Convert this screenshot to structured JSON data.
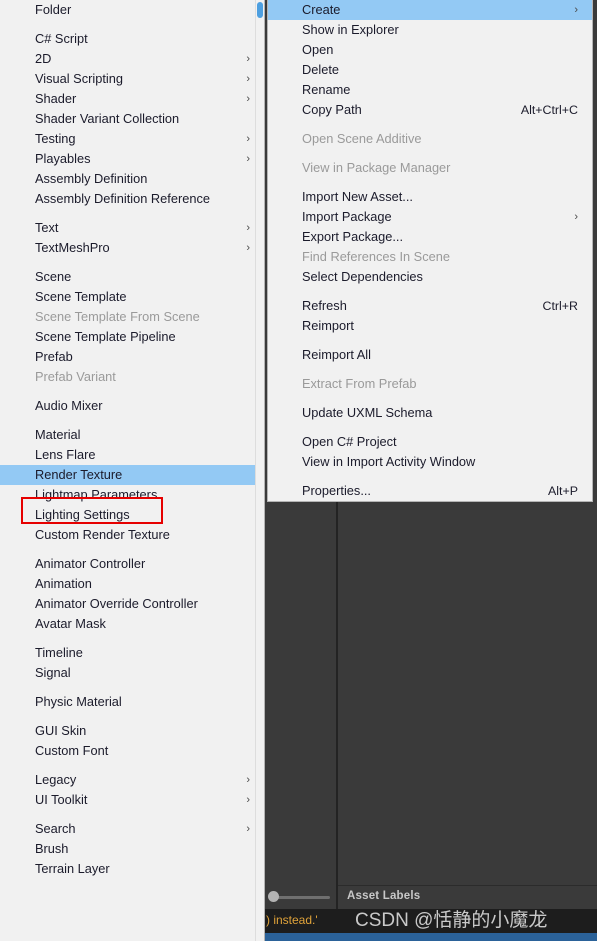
{
  "colors": {
    "menu_bg": "#f1f1f1",
    "highlight": "#93c9f4",
    "annotation": "#e60000",
    "unity_bg": "#383838",
    "console_text": "#e0a33a",
    "status_blue": "#2b6299"
  },
  "create_submenu": {
    "name": "Create",
    "items": [
      {
        "label": "Folder",
        "type": "item"
      },
      {
        "type": "separator"
      },
      {
        "label": "C# Script",
        "type": "item"
      },
      {
        "label": "2D",
        "type": "item",
        "arrow": "›"
      },
      {
        "label": "Visual Scripting",
        "type": "item",
        "arrow": "›"
      },
      {
        "label": "Shader",
        "type": "item",
        "arrow": "›"
      },
      {
        "label": "Shader Variant Collection",
        "type": "item"
      },
      {
        "label": "Testing",
        "type": "item",
        "arrow": "›"
      },
      {
        "label": "Playables",
        "type": "item",
        "arrow": "›"
      },
      {
        "label": "Assembly Definition",
        "type": "item"
      },
      {
        "label": "Assembly Definition Reference",
        "type": "item"
      },
      {
        "type": "separator"
      },
      {
        "label": "Text",
        "type": "item",
        "arrow": "›"
      },
      {
        "label": "TextMeshPro",
        "type": "item",
        "arrow": "›"
      },
      {
        "type": "separator"
      },
      {
        "label": "Scene",
        "type": "item"
      },
      {
        "label": "Scene Template",
        "type": "item"
      },
      {
        "label": "Scene Template From Scene",
        "type": "item",
        "disabled": true
      },
      {
        "label": "Scene Template Pipeline",
        "type": "item"
      },
      {
        "label": "Prefab",
        "type": "item"
      },
      {
        "label": "Prefab Variant",
        "type": "item",
        "disabled": true
      },
      {
        "type": "separator"
      },
      {
        "label": "Audio Mixer",
        "type": "item"
      },
      {
        "type": "separator"
      },
      {
        "label": "Material",
        "type": "item"
      },
      {
        "label": "Lens Flare",
        "type": "item"
      },
      {
        "label": "Render Texture",
        "type": "item",
        "selected": true,
        "annotated": true
      },
      {
        "label": "Lightmap Parameters",
        "type": "item"
      },
      {
        "label": "Lighting Settings",
        "type": "item"
      },
      {
        "label": "Custom Render Texture",
        "type": "item"
      },
      {
        "type": "separator"
      },
      {
        "label": "Animator Controller",
        "type": "item"
      },
      {
        "label": "Animation",
        "type": "item"
      },
      {
        "label": "Animator Override Controller",
        "type": "item"
      },
      {
        "label": "Avatar Mask",
        "type": "item"
      },
      {
        "type": "separator"
      },
      {
        "label": "Timeline",
        "type": "item"
      },
      {
        "label": "Signal",
        "type": "item"
      },
      {
        "type": "separator"
      },
      {
        "label": "Physic Material",
        "type": "item"
      },
      {
        "type": "separator"
      },
      {
        "label": "GUI Skin",
        "type": "item"
      },
      {
        "label": "Custom Font",
        "type": "item"
      },
      {
        "type": "separator"
      },
      {
        "label": "Legacy",
        "type": "item",
        "arrow": "›"
      },
      {
        "label": "UI Toolkit",
        "type": "item",
        "arrow": "›"
      },
      {
        "type": "separator"
      },
      {
        "label": "Search",
        "type": "item",
        "arrow": "›"
      },
      {
        "label": "Brush",
        "type": "item"
      },
      {
        "label": "Terrain Layer",
        "type": "item"
      }
    ]
  },
  "context_menu": {
    "items": [
      {
        "label": "Create",
        "type": "item",
        "arrow": "›",
        "selected": true
      },
      {
        "label": "Show in Explorer",
        "type": "item"
      },
      {
        "label": "Open",
        "type": "item"
      },
      {
        "label": "Delete",
        "type": "item"
      },
      {
        "label": "Rename",
        "type": "item"
      },
      {
        "label": "Copy Path",
        "type": "item",
        "shortcut": "Alt+Ctrl+C"
      },
      {
        "type": "separator"
      },
      {
        "label": "Open Scene Additive",
        "type": "item",
        "disabled": true
      },
      {
        "type": "separator"
      },
      {
        "label": "View in Package Manager",
        "type": "item",
        "disabled": true
      },
      {
        "type": "separator"
      },
      {
        "label": "Import New Asset...",
        "type": "item"
      },
      {
        "label": "Import Package",
        "type": "item",
        "arrow": "›"
      },
      {
        "label": "Export Package...",
        "type": "item"
      },
      {
        "label": "Find References In Scene",
        "type": "item",
        "disabled": true
      },
      {
        "label": "Select Dependencies",
        "type": "item"
      },
      {
        "type": "separator"
      },
      {
        "label": "Refresh",
        "type": "item",
        "shortcut": "Ctrl+R"
      },
      {
        "label": "Reimport",
        "type": "item"
      },
      {
        "type": "separator"
      },
      {
        "label": "Reimport All",
        "type": "item"
      },
      {
        "type": "separator"
      },
      {
        "label": "Extract From Prefab",
        "type": "item",
        "disabled": true
      },
      {
        "type": "separator"
      },
      {
        "label": "Update UXML Schema",
        "type": "item"
      },
      {
        "type": "separator"
      },
      {
        "label": "Open C# Project",
        "type": "item"
      },
      {
        "label": "View in Import Activity Window",
        "type": "item"
      },
      {
        "type": "separator"
      },
      {
        "label": "Properties...",
        "type": "item",
        "shortcut": "Alt+P"
      }
    ]
  },
  "editor_background": {
    "asset_labels": "Asset Labels",
    "console_message": ") instead.'",
    "watermark": "CSDN @恬静的小魔龙"
  }
}
